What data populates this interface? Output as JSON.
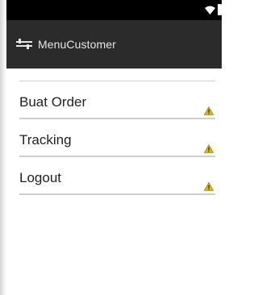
{
  "status_bar": {
    "icons": [
      "wifi-icon",
      "battery-icon"
    ]
  },
  "action_bar": {
    "icon": "app-icon",
    "title": "MenuCustomer"
  },
  "menu": {
    "items": [
      {
        "label": "Buat Order",
        "indicator": "warning-icon"
      },
      {
        "label": "Tracking",
        "indicator": "warning-icon"
      },
      {
        "label": "Logout",
        "indicator": "warning-icon"
      }
    ]
  },
  "colors": {
    "status_bar": "#000000",
    "action_bar": "#2b2b2b",
    "title_text": "#e6e6e6",
    "divider": "#cfcfcf",
    "warning": "#e2b21a"
  }
}
